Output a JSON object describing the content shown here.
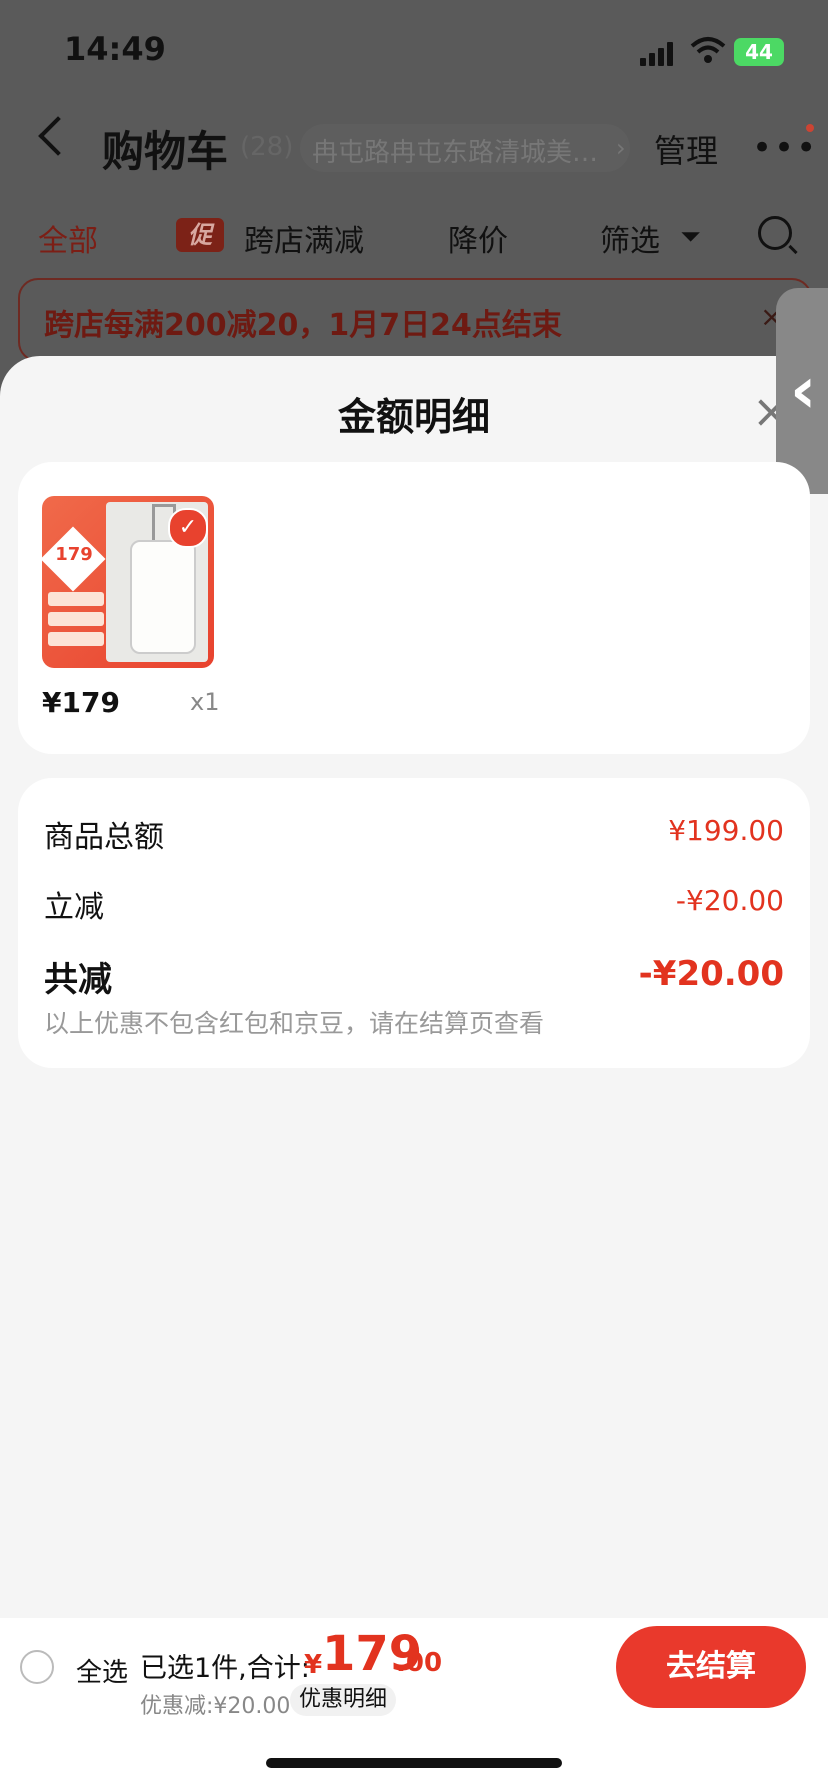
{
  "status_bar": {
    "time": "14:49",
    "battery": "44"
  },
  "header": {
    "title": "购物车",
    "count": "(28)",
    "address": "冉屯路冉屯东路清城美…",
    "address_arrow": "›",
    "manage": "管理",
    "more": "•••"
  },
  "filters": {
    "all": "全部",
    "promo_badge": "促",
    "cross_store": "跨店满减",
    "price_drop": "降价",
    "filter": "筛选"
  },
  "banner": {
    "text": "跨店每满200减20，1月7日24点结束",
    "close": "×"
  },
  "sheet": {
    "title": "金额明细",
    "close": "×",
    "item": {
      "thumb_price": "179",
      "price": "¥179",
      "qty": "x1"
    },
    "rows": [
      {
        "label": "商品总额",
        "value": "¥199.00"
      },
      {
        "label": "立减",
        "value": "-¥20.00"
      }
    ],
    "summary": {
      "label": "共减",
      "value": "-¥20.00"
    },
    "note": "以上优惠不包含红包和京豆，请在结算页查看"
  },
  "bottom": {
    "select_all": "全选",
    "selected_prefix": "已选1件,合计:",
    "currency": "¥",
    "total_int": "179",
    "total_dec": ".00",
    "discount": "优惠减:¥20.00",
    "detail": "优惠明细",
    "checkout": "去结算"
  },
  "colors": {
    "accent": "#e2331f",
    "checkout_bg": "#e9392c"
  }
}
